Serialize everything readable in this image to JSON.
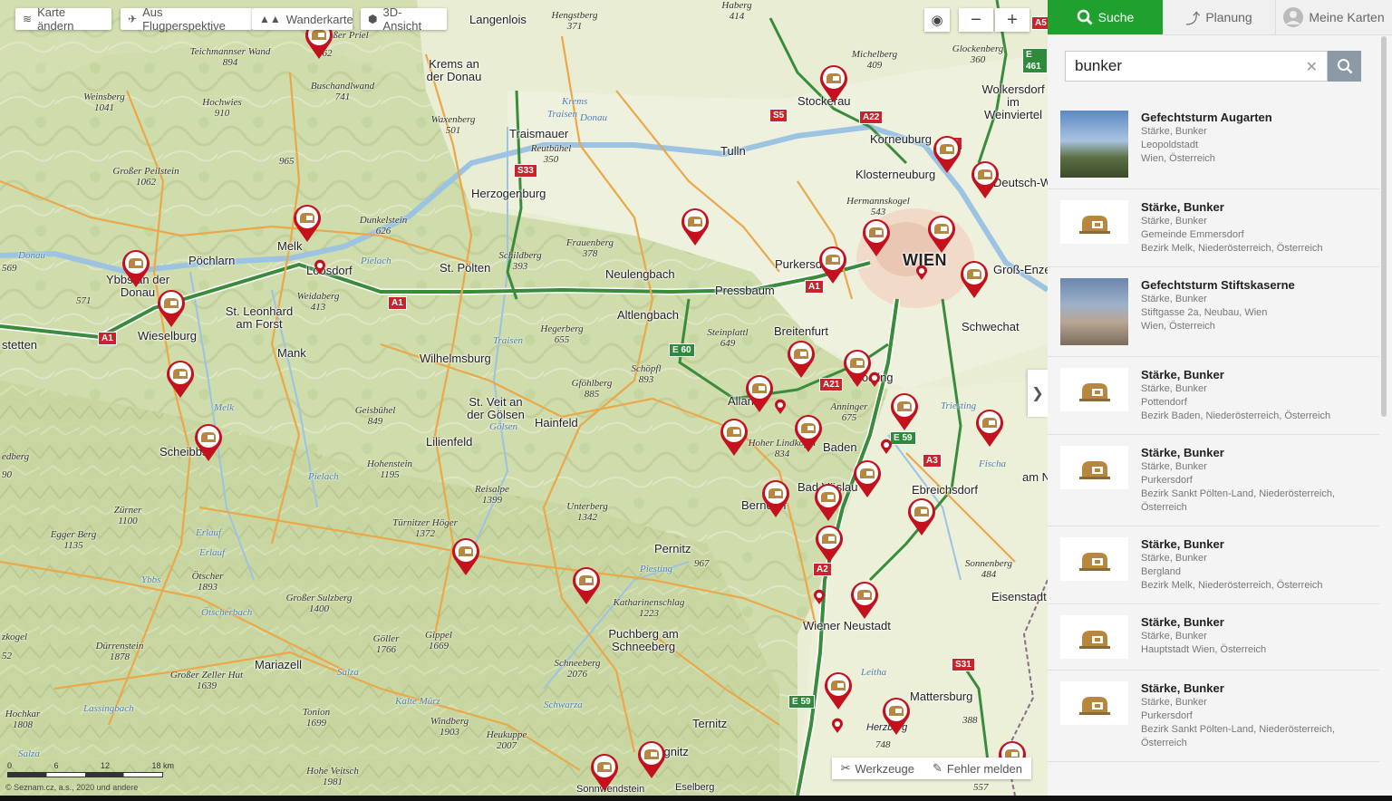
{
  "toolbar": {
    "change_map": "Karte ändern",
    "aerial": "Aus Flugperspektive",
    "hiking": "Wanderkarte",
    "view3d": "3D-Ansicht",
    "zoom_out": "−",
    "zoom_in": "+"
  },
  "bottom_tools": {
    "tools": "Werkzeuge",
    "report": "Fehler melden"
  },
  "scale": {
    "labels": [
      "0",
      "6",
      "12",
      "18 km"
    ]
  },
  "copyright": "© Seznam.cz, a.s., 2020 und andere",
  "panel": {
    "tabs": [
      {
        "label": "Suche"
      },
      {
        "label": "Planung"
      },
      {
        "label": "Meine Karten"
      }
    ],
    "search": {
      "value": "bunker"
    },
    "results": [
      {
        "title": "Gefechtsturm Augarten",
        "lines": [
          "Stärke, Bunker",
          "Leopoldstadt",
          "Wien, Österreich"
        ],
        "thumb": "photo1"
      },
      {
        "title": "Stärke, Bunker",
        "lines": [
          "Stärke, Bunker",
          "Gemeinde Emmersdorf",
          "Bezirk Melk, Niederösterreich, Österreich"
        ],
        "thumb": "icon"
      },
      {
        "title": "Gefechtsturm Stiftskaserne",
        "lines": [
          "Stärke, Bunker",
          "Stiftgasse 2a, Neubau, Wien",
          "Wien, Österreich"
        ],
        "thumb": "photo2"
      },
      {
        "title": "Stärke, Bunker",
        "lines": [
          "Stärke, Bunker",
          "Pottendorf",
          "Bezirk Baden, Niederösterreich, Österreich"
        ],
        "thumb": "icon"
      },
      {
        "title": "Stärke, Bunker",
        "lines": [
          "Stärke, Bunker",
          "Purkersdorf",
          "Bezirk Sankt Pölten-Land, Niederösterreich,",
          "Österreich"
        ],
        "thumb": "icon"
      },
      {
        "title": "Stärke, Bunker",
        "lines": [
          "Stärke, Bunker",
          "Bergland",
          "Bezirk Melk, Niederösterreich, Österreich"
        ],
        "thumb": "icon"
      },
      {
        "title": "Stärke, Bunker",
        "lines": [
          "Stärke, Bunker",
          "Hauptstadt Wien, Österreich"
        ],
        "thumb": "icon"
      },
      {
        "title": "Stärke, Bunker",
        "lines": [
          "Stärke, Bunker",
          "Purkersdorf",
          "Bezirk Sankt Pölten-Land, Niederösterreich,",
          "Österreich"
        ],
        "thumb": "icon"
      }
    ]
  },
  "map": {
    "places": [
      "Krems an der Donau",
      "Langenlois",
      "Stockerau",
      "Korneuburg",
      "Klosterneuburg",
      "Deutsch-W",
      "Wolkersdorf im Weinviertel",
      "Traismauer",
      "Herzogenburg",
      "Tulln",
      "Melk",
      "Loosdorf",
      "Pöchlarn",
      "Ybbs an der Donau",
      "Wieselburg",
      "St. Leonhard am Forst",
      "St. Pölten",
      "Neulengbach",
      "Purkersdorf",
      "Pressbaum",
      "WIEN",
      "Groß-Enze",
      "Schwechat",
      "Altlengbach",
      "Breitenfurt",
      "Mödling",
      "Alland",
      "Baden",
      "Bad Vöslau",
      "Berndorf",
      "Ebreichsdorf",
      "Wilhelmsburg",
      "St. Veit an der Gölsen",
      "Hainfeld",
      "Lilienfeld",
      "Mank",
      "Scheibbs",
      "Pernitz",
      "Puchberg am Schneeberg",
      "Wiener Neustadt",
      "Mattersburg",
      "Eisenstadt",
      "Mariazell",
      "Ternitz",
      "Gloggnitz",
      "Sonnwendstein",
      "Eselberg",
      "stetten",
      "Herzberg",
      "am Ne"
    ],
    "peaks": [
      "Hengstberg 371",
      "Haberg 414",
      "Teichmannser Wand 894",
      "Weinsberg 1041",
      "Hochwies 910",
      "Buschandlwand 741",
      "965",
      "Waxenberg 501",
      "Reutbühel 350",
      "Großer Peilstein 1062",
      "Dunkelstein 626",
      "Frauenberg 378",
      "Schildberg 393",
      "Hermannskogel 543",
      "Michelberg 409",
      "Glockenberg 360",
      "Weidaberg 413",
      "Hegerberg 655",
      "Steinplattl 649",
      "Schöpfl 893",
      "Gföhlberg 885",
      "Anninger 675",
      "Hoher Lindkogel 834",
      "Geisbühel 849",
      "Hohenstein 1195",
      "Reisalpe 1399",
      "Unterberg 1342",
      "Türnitzer Höger 1372",
      "Zürner 1100",
      "Egger Berg 1135",
      "Ötscher 1893",
      "Großer Sulzberg 1400",
      "Katharinenschlag 1223",
      "Gippel 1669",
      "Göller 1766",
      "Schneeberg 2076",
      "Dürrenstein 1878",
      "Großer Zeller Hut 1639",
      "Tonion 1699",
      "Windberg 1903",
      "Heukuppe 2007",
      "Hochkar 1808",
      "Hohe Veitsch 1981",
      "Sonnenberg 484",
      "388",
      "748",
      "967",
      "569",
      "571",
      "90",
      "52",
      "zkogel",
      "edberg",
      "557",
      "662",
      "Großer Priel"
    ],
    "rivers": [
      "Donau",
      "Krems",
      "Traisen",
      "Donau",
      "Pielach",
      "Pielach",
      "Melk",
      "Erlauf",
      "Ybbs",
      "Traisen",
      "Gölsen",
      "Piesting",
      "Triesting",
      "Fischa",
      "Leitha",
      "Schwarza",
      "Salza",
      "Kalte Mürz",
      "Lassingbach",
      "Ötscherbach",
      "Erlauf",
      "Salza"
    ],
    "shields": [
      "A1",
      "A1",
      "A1",
      "S5",
      "A22",
      "S1",
      "S33",
      "A21",
      "E 60",
      "A2",
      "E 59",
      "A3",
      "S31",
      "E 59",
      "A5",
      "E 461"
    ]
  }
}
